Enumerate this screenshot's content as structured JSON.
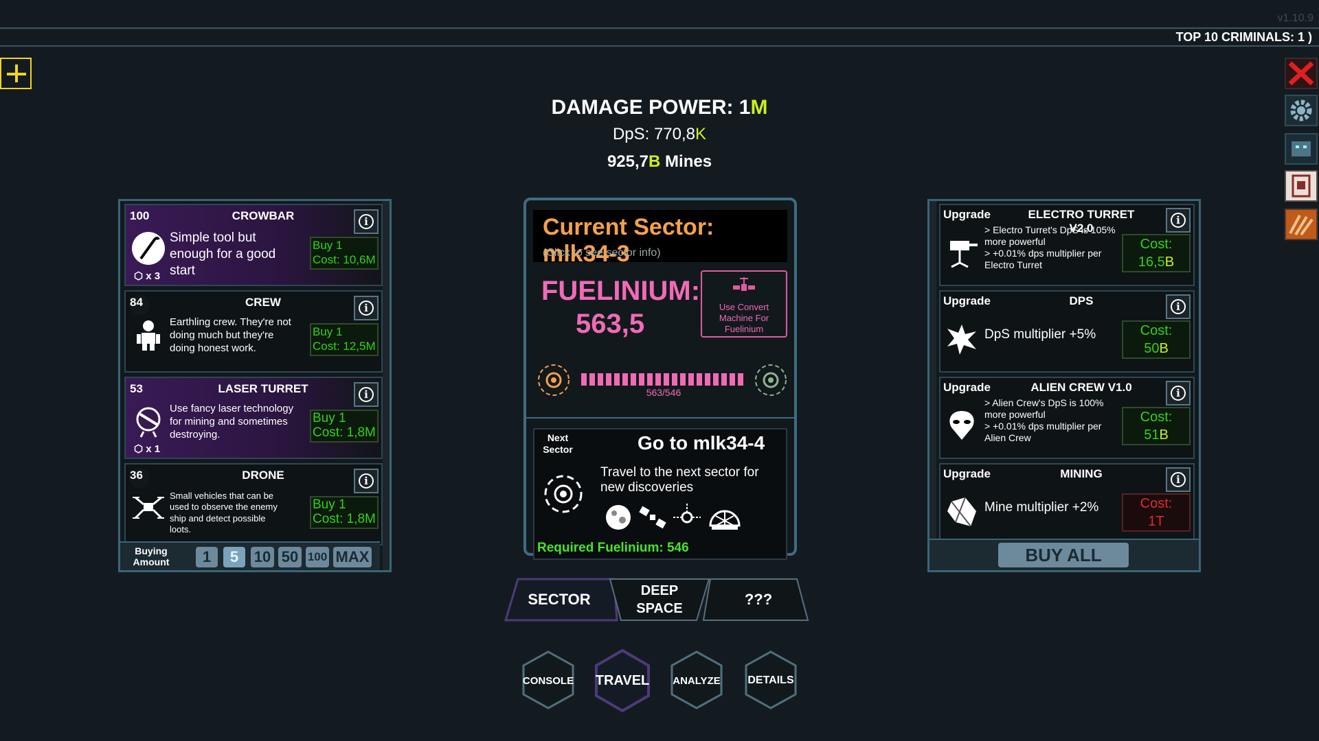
{
  "version": "v1.10.9",
  "top_criminals": "TOP 10 CRIMINALS:   1 )",
  "header": {
    "damage_label": "DAMAGE POWER: 1",
    "damage_suffix": "M",
    "dps_label": "DpS: 770,8",
    "dps_suffix": "K",
    "mines_value": "925,7",
    "mines_suffix": "B",
    "mines_label": " Mines"
  },
  "left_panel": {
    "items": [
      {
        "level": "100",
        "title": "CROWBAR",
        "desc": "Simple tool but enough for a good start",
        "buy": "Buy 1",
        "cost": "Cost: 10,6M",
        "mult": "x 3"
      },
      {
        "level": "84",
        "title": "CREW",
        "desc": "Earthling crew. They're not doing much but they're doing honest work.",
        "buy": "Buy 1",
        "cost": "Cost: 12,5M"
      },
      {
        "level": "53",
        "title": "LASER TURRET",
        "desc": "Use fancy laser technology for mining and sometimes destroying.",
        "buy": "Buy 1",
        "cost": "Cost: 1,8M",
        "mult": "x 1"
      },
      {
        "level": "36",
        "title": "DRONE",
        "desc": "Small vehicles that can be used to observe the enemy ship and detect possible loots.",
        "buy": "Buy 1",
        "cost": "Cost: 1,8M"
      }
    ],
    "buying_label": "Buying Amount",
    "amounts": [
      "1",
      "5",
      "10",
      "50",
      "100",
      "MAX"
    ]
  },
  "center": {
    "sector_title": "Current Sector: mlk34-3",
    "sector_sub": "(Click to see sector info)",
    "fuel_label": "FUELINIUM:",
    "fuel_value": "563,5",
    "convert_label": "Use Convert Machine For Fuelinium",
    "progress_text": "563/546",
    "progress_fraction": 1.0,
    "next_tag": "Next Sector",
    "next_title": "Go to mlk34-4",
    "next_desc": "Travel to the next sector for new discoveries",
    "required": "Required Fuelinium: 546"
  },
  "tabs": [
    "SECTOR",
    "DEEP SPACE",
    "???"
  ],
  "bottom_buttons": [
    "CONSOLE",
    "TRAVEL",
    "ANALYZE",
    "DETAILS"
  ],
  "right_panel": {
    "upgrades": [
      {
        "tag": "Upgrade",
        "title": "ELECTRO TURRET V2.0",
        "desc": "> Electro Turret's DpS is 105% more powerful\n> +0.01% dps multiplier per Electro Turret",
        "cost_label": "Cost:",
        "cost_value": "16,5",
        "cost_suffix": "B"
      },
      {
        "tag": "Upgrade",
        "title": "DPS",
        "desc": "DpS multiplier +5%",
        "cost_label": "Cost:",
        "cost_value": "50",
        "cost_suffix": "B"
      },
      {
        "tag": "Upgrade",
        "title": "ALIEN CREW V1.0",
        "desc": "> Alien Crew's DpS is 100% more powerful\n> +0.01% dps multiplier per Alien Crew",
        "cost_label": "Cost:",
        "cost_value": "51",
        "cost_suffix": "B"
      },
      {
        "tag": "Upgrade",
        "title": "MINING",
        "desc": "Mine multiplier +2%",
        "cost_label": "Cost:",
        "cost_value": "1",
        "cost_suffix": "T"
      }
    ],
    "buy_all": "BUY ALL"
  },
  "colors": {
    "accent_yellow": "#c9f21b",
    "fuel_pink": "#f06bb5",
    "sector_orange": "#f6a14d",
    "buy_green": "#34d11e",
    "cost_red": "#e02a2a"
  }
}
